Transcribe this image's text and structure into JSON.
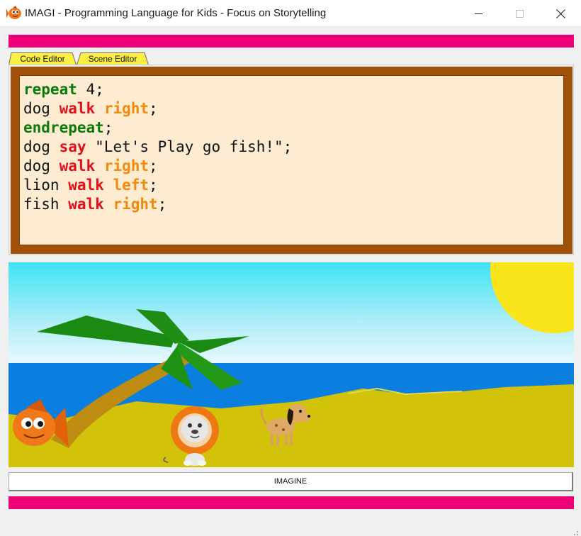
{
  "window": {
    "title": "IMAGI - Programming Language for Kids - Focus on Storytelling"
  },
  "colors": {
    "accent_bar": "#ee0077",
    "tab_active": "#ffee44",
    "editor_frame": "#a0510a",
    "editor_bg": "#fdecd2",
    "keyword_green": "#0a7a0a",
    "keyword_red": "#e0101a",
    "keyword_orange": "#f08a0a"
  },
  "tabs": [
    {
      "label": "Code Editor",
      "active": true
    },
    {
      "label": "Scene Editor",
      "active": false
    }
  ],
  "code": {
    "lines": [
      [
        {
          "t": "repeat",
          "c": "green"
        },
        {
          "t": " 4;",
          "c": "plain"
        }
      ],
      [
        {
          "t": "dog ",
          "c": "plain"
        },
        {
          "t": "walk",
          "c": "red"
        },
        {
          "t": " ",
          "c": "plain"
        },
        {
          "t": "right",
          "c": "orange"
        },
        {
          "t": ";",
          "c": "plain"
        }
      ],
      [
        {
          "t": "endrepeat",
          "c": "green"
        },
        {
          "t": ";",
          "c": "plain"
        }
      ],
      [
        {
          "t": "dog ",
          "c": "plain"
        },
        {
          "t": "say",
          "c": "red"
        },
        {
          "t": " \"Let's Play go fish!\";",
          "c": "plain"
        }
      ],
      [
        {
          "t": "dog ",
          "c": "plain"
        },
        {
          "t": "walk",
          "c": "red"
        },
        {
          "t": " ",
          "c": "plain"
        },
        {
          "t": "right",
          "c": "orange"
        },
        {
          "t": ";",
          "c": "plain"
        }
      ],
      [
        {
          "t": "lion ",
          "c": "plain"
        },
        {
          "t": "walk",
          "c": "red"
        },
        {
          "t": " ",
          "c": "plain"
        },
        {
          "t": "left",
          "c": "orange"
        },
        {
          "t": ";",
          "c": "plain"
        }
      ],
      [
        {
          "t": "fish ",
          "c": "plain"
        },
        {
          "t": "walk",
          "c": "red"
        },
        {
          "t": " ",
          "c": "plain"
        },
        {
          "t": "right",
          "c": "orange"
        },
        {
          "t": ";",
          "c": "plain"
        }
      ]
    ]
  },
  "scene": {
    "characters": [
      "fish",
      "lion",
      "dog"
    ]
  },
  "actions": {
    "imagine_label": "IMAGINE"
  },
  "icons": {
    "app": "fish-logo-icon",
    "minimize": "minimize-icon",
    "maximize": "maximize-icon",
    "close": "close-icon"
  }
}
